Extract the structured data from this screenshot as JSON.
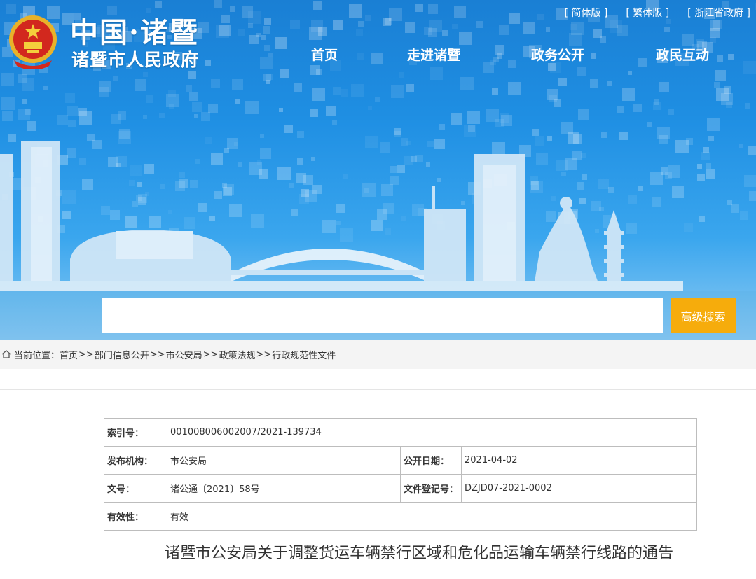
{
  "header": {
    "logo_line1": "中国·诸暨",
    "logo_line2": "诸暨市人民政府",
    "top_links": [
      "[ 简体版 ]",
      "[ 繁体版 ]",
      "[ 浙江省政府 ]"
    ],
    "nav": [
      "首页",
      "走进诸暨",
      "政务公开",
      "政民互动"
    ]
  },
  "search": {
    "value": "",
    "button_label": "高级搜索"
  },
  "breadcrumb": {
    "prefix": "当前位置：",
    "items": [
      "首页",
      "部门信息公开",
      "市公安局",
      "政策法规",
      "行政规范性文件"
    ],
    "separator": ">>"
  },
  "info": {
    "index_label": "索引号：",
    "index_value": "001008006002007/2021-139734",
    "publisher_label": "发布机构：",
    "publisher_value": "市公安局",
    "date_label": "公开日期：",
    "date_value": "2021-04-02",
    "docno_label": "文号：",
    "docno_value": "诸公通〔2021〕58号",
    "regno_label": "文件登记号：",
    "regno_value": "DZJD07-2021-0002",
    "validity_label": "有效性：",
    "validity_value": "有效"
  },
  "document": {
    "title": "诸暨市公安局关于调整货运车辆禁行区域和危化品运输车辆禁行线路的通告"
  },
  "colors": {
    "banner_blue": "#1f8fe3",
    "search_button": "#f6ac0c"
  }
}
